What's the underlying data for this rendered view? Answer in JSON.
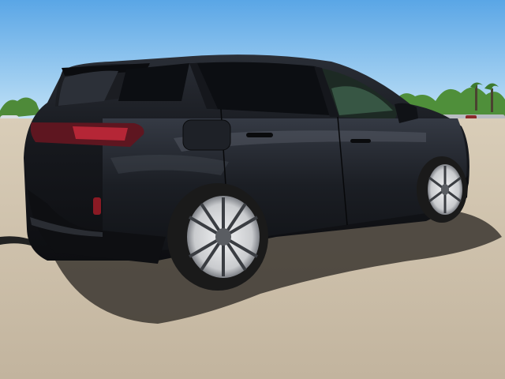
{
  "scene": {
    "description_visible_text": "",
    "colors": {
      "sky_top": "#5ea9e6",
      "sky_bottom": "#bfe0f6",
      "ground_near": "#c9bca7",
      "ground_far": "#d8cbb5",
      "trees": "#4f8f3a",
      "car_body": "#15171c",
      "car_highlight": "#3a3f49",
      "window": "#0c0e12",
      "taillight": "#8d1d2b",
      "wheel_face": "#d9dadc",
      "tire": "#1a1a1a",
      "shadow": "#3b3630"
    }
  }
}
